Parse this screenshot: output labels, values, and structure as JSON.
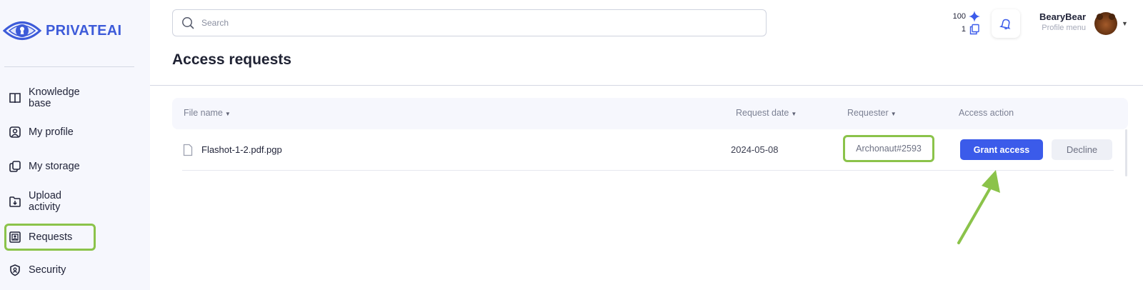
{
  "brand": {
    "name": "PRIVATEAI",
    "logo_icon": "eye-keyhole-icon",
    "accent": "#3d5bd9"
  },
  "sidebar": {
    "items": [
      {
        "label": "Knowledge base",
        "icon": "book-icon"
      },
      {
        "label": "My profile",
        "icon": "user-badge-icon"
      },
      {
        "label": "My storage",
        "icon": "copy-files-icon"
      },
      {
        "label": "Upload activity",
        "icon": "folder-download-icon"
      },
      {
        "label": "Requests",
        "icon": "id-card-icon",
        "highlighted": true
      },
      {
        "label": "Security",
        "icon": "shield-icon"
      }
    ]
  },
  "header": {
    "search_placeholder": "Search",
    "credits": {
      "sparkles": "100",
      "files": "1"
    },
    "user": {
      "name": "BearyBear",
      "menu_label": "Profile menu"
    }
  },
  "page": {
    "title": "Access requests"
  },
  "table": {
    "columns": {
      "file_name": "File name",
      "request_date": "Request date",
      "requester": "Requester",
      "access_action": "Access action"
    },
    "rows": [
      {
        "file_name": "Flashot-1-2.pdf.pgp",
        "request_date": "2024-05-08",
        "requester": "Archonaut#2593",
        "grant_label": "Grant access",
        "decline_label": "Decline"
      }
    ]
  },
  "colors": {
    "highlight": "#8bc34a",
    "primary_button": "#3b5bea",
    "arrow": "#8bc34a"
  }
}
